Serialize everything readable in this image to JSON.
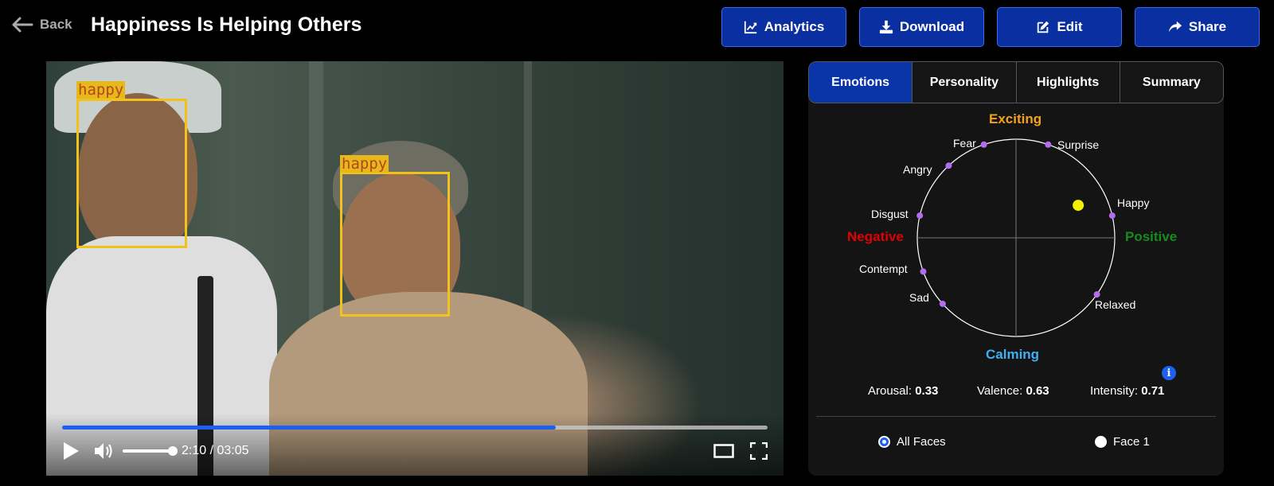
{
  "header": {
    "back_label": "Back",
    "title": "Happiness Is Helping Others",
    "actions": [
      {
        "label": "Analytics",
        "icon": "chart-line-icon"
      },
      {
        "label": "Download",
        "icon": "download-icon"
      },
      {
        "label": "Edit",
        "icon": "edit-icon"
      },
      {
        "label": "Share",
        "icon": "share-icon"
      }
    ]
  },
  "video": {
    "faces": [
      {
        "label": "happy"
      },
      {
        "label": "happy"
      }
    ],
    "progress_fraction": 0.7,
    "volume_fraction": 1.0,
    "time_display": "2:10 / 03:05"
  },
  "panel": {
    "tabs": [
      {
        "label": "Emotions",
        "active": true
      },
      {
        "label": "Personality",
        "active": false
      },
      {
        "label": "Highlights",
        "active": false
      },
      {
        "label": "Summary",
        "active": false
      }
    ],
    "wheel": {
      "top_label": "Exciting",
      "bottom_label": "Calming",
      "left_label": "Negative",
      "right_label": "Positive",
      "emotions": [
        "Fear",
        "Surprise",
        "Angry",
        "Happy",
        "Disgust",
        "Contempt",
        "Sad",
        "Relaxed"
      ],
      "current_valence": 0.63,
      "current_arousal": 0.33
    },
    "metrics": {
      "arousal_label": "Arousal:",
      "arousal_value": "0.33",
      "valence_label": "Valence:",
      "valence_value": "0.63",
      "intensity_label": "Intensity:",
      "intensity_value": "0.71"
    },
    "face_options": [
      {
        "label": "All Faces",
        "checked": true
      },
      {
        "label": "Face 1",
        "checked": false
      }
    ]
  },
  "colors": {
    "accent_blue": "#0a35a8",
    "exciting": "#f5a21b",
    "calming": "#3fb0f0",
    "negative": "#e00000",
    "positive": "#1a8a1a",
    "emotion_dot": "#b56cf0",
    "current_dot": "#f5f000",
    "face_box": "#f2c21b"
  }
}
